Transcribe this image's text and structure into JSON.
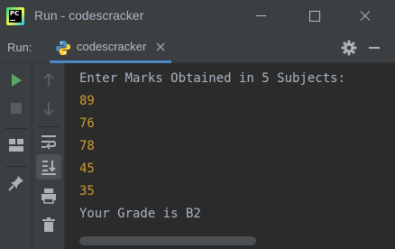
{
  "window": {
    "title": "Run - codescracker"
  },
  "run_panel": {
    "label": "Run:",
    "tab_label": "codescracker"
  },
  "console": {
    "prompt": "Enter Marks Obtained in 5 Subjects:",
    "inputs": [
      "89",
      "76",
      "78",
      "45",
      "35"
    ],
    "result": "Your Grade is B2"
  },
  "colors": {
    "output_text": "#a9b7c6",
    "input_text": "#cc9d32",
    "run_green": "#59a869",
    "tab_underline": "#4a88c7"
  }
}
